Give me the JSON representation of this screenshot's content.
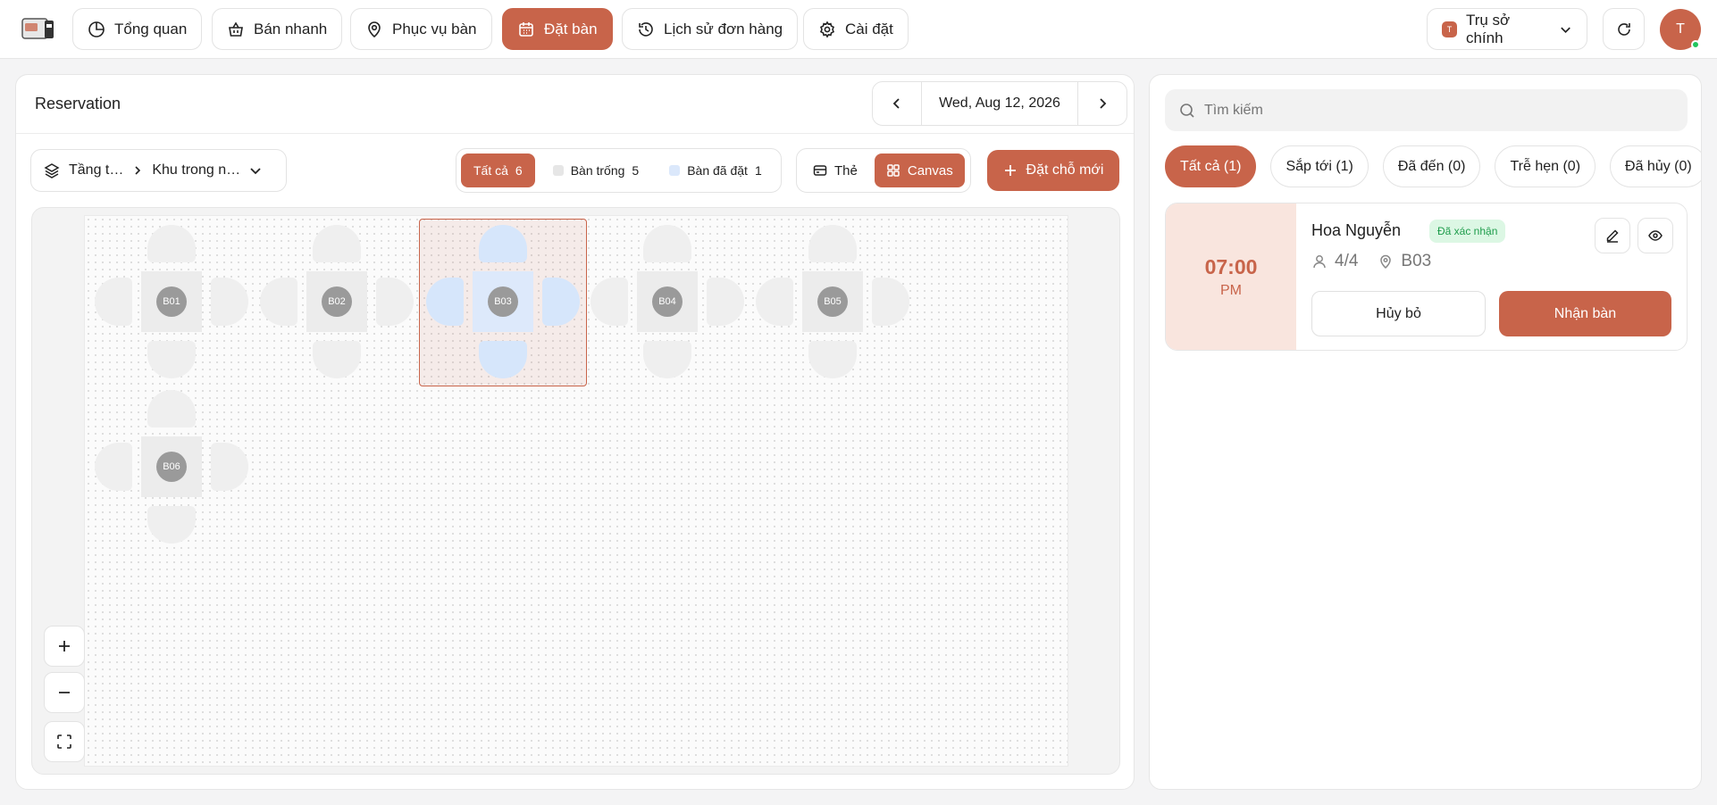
{
  "nav": {
    "items": [
      {
        "label": "Tổng quan",
        "icon": "pie-chart-icon",
        "active": false
      },
      {
        "label": "Bán nhanh",
        "icon": "basket-icon",
        "active": false
      },
      {
        "label": "Phục vụ bàn",
        "icon": "waiter-icon",
        "active": false
      },
      {
        "label": "Đặt bàn",
        "icon": "calendar-icon",
        "active": true
      },
      {
        "label": "Lịch sử đơn hàng",
        "icon": "history-icon",
        "active": false
      },
      {
        "label": "Cài đặt",
        "icon": "gear-icon",
        "active": false
      }
    ],
    "branch": {
      "badge": "T",
      "label": "Trụ sở chính"
    },
    "avatar": "T"
  },
  "reservation": {
    "title": "Reservation",
    "date": "Wed, Aug 12, 2026",
    "area": {
      "floor": "Tầng t…",
      "zone": "Khu trong n…"
    },
    "filters": [
      {
        "label": "Tất cả",
        "count": "6",
        "active": true
      },
      {
        "label": "Bàn trống",
        "count": "5",
        "active": false,
        "swatch": "#e6e6e6"
      },
      {
        "label": "Bàn đã đặt",
        "count": "1",
        "active": false,
        "swatch": "#dbe8fb"
      }
    ],
    "views": [
      {
        "label": "Thẻ",
        "icon": "card-icon",
        "active": false
      },
      {
        "label": "Canvas",
        "icon": "grid-icon",
        "active": true
      }
    ],
    "new_button": "Đặt chỗ mới",
    "tables": [
      {
        "id": "B01",
        "status": "empty"
      },
      {
        "id": "B02",
        "status": "empty"
      },
      {
        "id": "B03",
        "status": "booked",
        "selected": true
      },
      {
        "id": "B04",
        "status": "empty"
      },
      {
        "id": "B05",
        "status": "empty"
      },
      {
        "id": "B06",
        "status": "empty"
      }
    ]
  },
  "sidebar": {
    "search_placeholder": "Tìm kiếm",
    "tabs": [
      {
        "label": "Tất cả (1)",
        "active": true
      },
      {
        "label": "Sắp tới (1)",
        "active": false
      },
      {
        "label": "Đã đến (0)",
        "active": false
      },
      {
        "label": "Trễ hẹn (0)",
        "active": false
      },
      {
        "label": "Đã hủy (0)",
        "active": false
      }
    ],
    "card": {
      "time": "07:00",
      "ampm": "PM",
      "name": "Hoa Nguyễn",
      "status": "Đã xác nhận",
      "guests": "4/4",
      "table": "B03",
      "cancel": "Hủy bỏ",
      "accept": "Nhận bàn"
    }
  },
  "colors": {
    "accent": "#c8644a",
    "booked": "#d6e6fb",
    "confirmed": "#1f9d4c"
  }
}
